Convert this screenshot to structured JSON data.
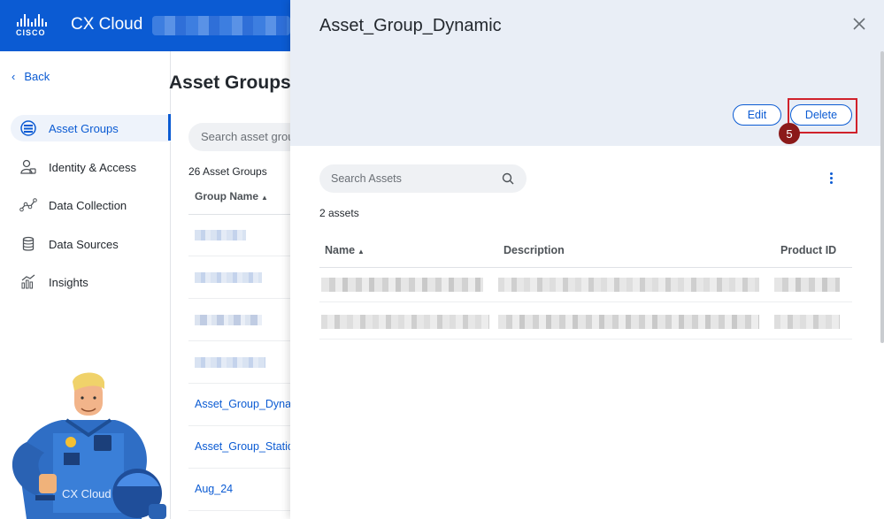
{
  "topbar": {
    "brand_word": "CISCO",
    "app_title": "CX Cloud"
  },
  "sidebar": {
    "back_label": "Back",
    "items": [
      {
        "label": "Asset Groups",
        "icon": "asset-groups-icon",
        "active": true
      },
      {
        "label": "Identity & Access",
        "icon": "identity-access-icon",
        "active": false
      },
      {
        "label": "Data Collection",
        "icon": "data-collection-icon",
        "active": false
      },
      {
        "label": "Data Sources",
        "icon": "data-sources-icon",
        "active": false
      },
      {
        "label": "Insights",
        "icon": "insights-icon",
        "active": false
      }
    ]
  },
  "mascot": {
    "badge_text": "CX Cloud"
  },
  "main": {
    "title": "Asset Groups",
    "search_placeholder": "Search asset groups",
    "count_label": "26 Asset Groups",
    "column_header": "Group Name",
    "groups": [
      {
        "name": "Asset_Group_Dynamic"
      },
      {
        "name": "Asset_Group_Static"
      },
      {
        "name": "Aug_24"
      }
    ]
  },
  "panel": {
    "title": "Asset_Group_Dynamic",
    "edit_label": "Edit",
    "delete_label": "Delete",
    "step_number": "5",
    "search_placeholder": "Search Assets",
    "asset_count": "2 assets",
    "columns": {
      "name": "Name",
      "description": "Description",
      "product_id": "Product ID"
    },
    "accent_color": "#0b5bd3",
    "highlight_color": "#d0212b"
  }
}
